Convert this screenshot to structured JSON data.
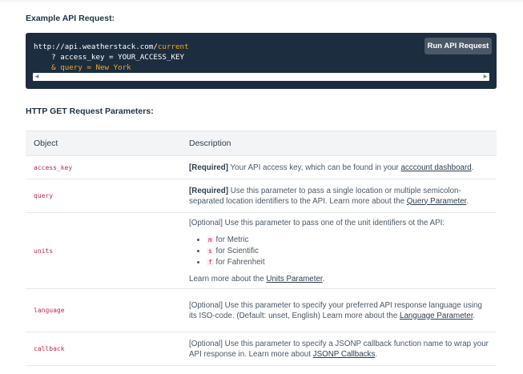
{
  "example_heading": "Example API Request:",
  "code": {
    "base": "http://api.weatherstack.com/",
    "endpoint": "current",
    "line2": "    ? access_key = YOUR_ACCESS_KEY",
    "line3": "    & query = New York"
  },
  "run_button": "Run API Request",
  "params_heading": "HTTP GET Request Parameters:",
  "table": {
    "headers": [
      "Object",
      "Description"
    ],
    "rows": [
      {
        "object": "access_key",
        "tag": "[Required]",
        "text": " Your API access key, which can be found in your ",
        "link": "acccount dashboard",
        "after": "."
      },
      {
        "object": "query",
        "tag": "[Required]",
        "text": " Use this parameter to pass a single location or multiple semicolon-separated location identifiers to the API. Learn more about the ",
        "link": "Query Parameter",
        "after": "."
      },
      {
        "object": "units",
        "tag": "[Optional]",
        "text": " Use this parameter to pass one of the unit identifiers ot the API:",
        "bullets": [
          {
            "code": "m",
            "label": " for Metric"
          },
          {
            "code": "s",
            "label": " for Scientific"
          },
          {
            "code": "f",
            "label": " for Fahrenheit"
          }
        ],
        "more": "Learn more about the ",
        "link": "Units Parameter",
        "after": "."
      },
      {
        "object": "language",
        "tag": "[Optional]",
        "text": " Use this parameter to specify your preferred API response language using its ISO-code. (Default: unset, English) Learn more about the ",
        "link": "Language Parameter",
        "after": "."
      },
      {
        "object": "callback",
        "tag": "[Optional]",
        "text": " Use this parameter to specify a JSONP callback function name to wrap your API response in. Learn more about ",
        "link": "JSONP Callbacks",
        "after": "."
      }
    ]
  }
}
